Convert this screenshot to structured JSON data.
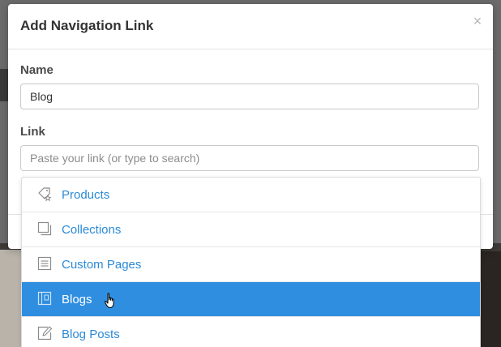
{
  "modal": {
    "title": "Add Navigation Link",
    "close_icon": "close-icon"
  },
  "form": {
    "name_label": "Name",
    "name_value": "Blog",
    "link_label": "Link",
    "link_value": "",
    "link_placeholder": "Paste your link (or type to search)"
  },
  "dropdown": {
    "items": [
      {
        "label": "Products",
        "icon": "tag-star-icon",
        "selected": false
      },
      {
        "label": "Collections",
        "icon": "stacked-squares-icon",
        "selected": false
      },
      {
        "label": "Custom Pages",
        "icon": "document-lines-icon",
        "selected": false
      },
      {
        "label": "Blogs",
        "icon": "notebook-icon",
        "selected": true
      },
      {
        "label": "Blog Posts",
        "icon": "edit-page-icon",
        "selected": false
      }
    ]
  },
  "colors": {
    "link_blue": "#2a8ad6",
    "highlight_blue": "#2f8ee0",
    "title_text": "#333333"
  }
}
